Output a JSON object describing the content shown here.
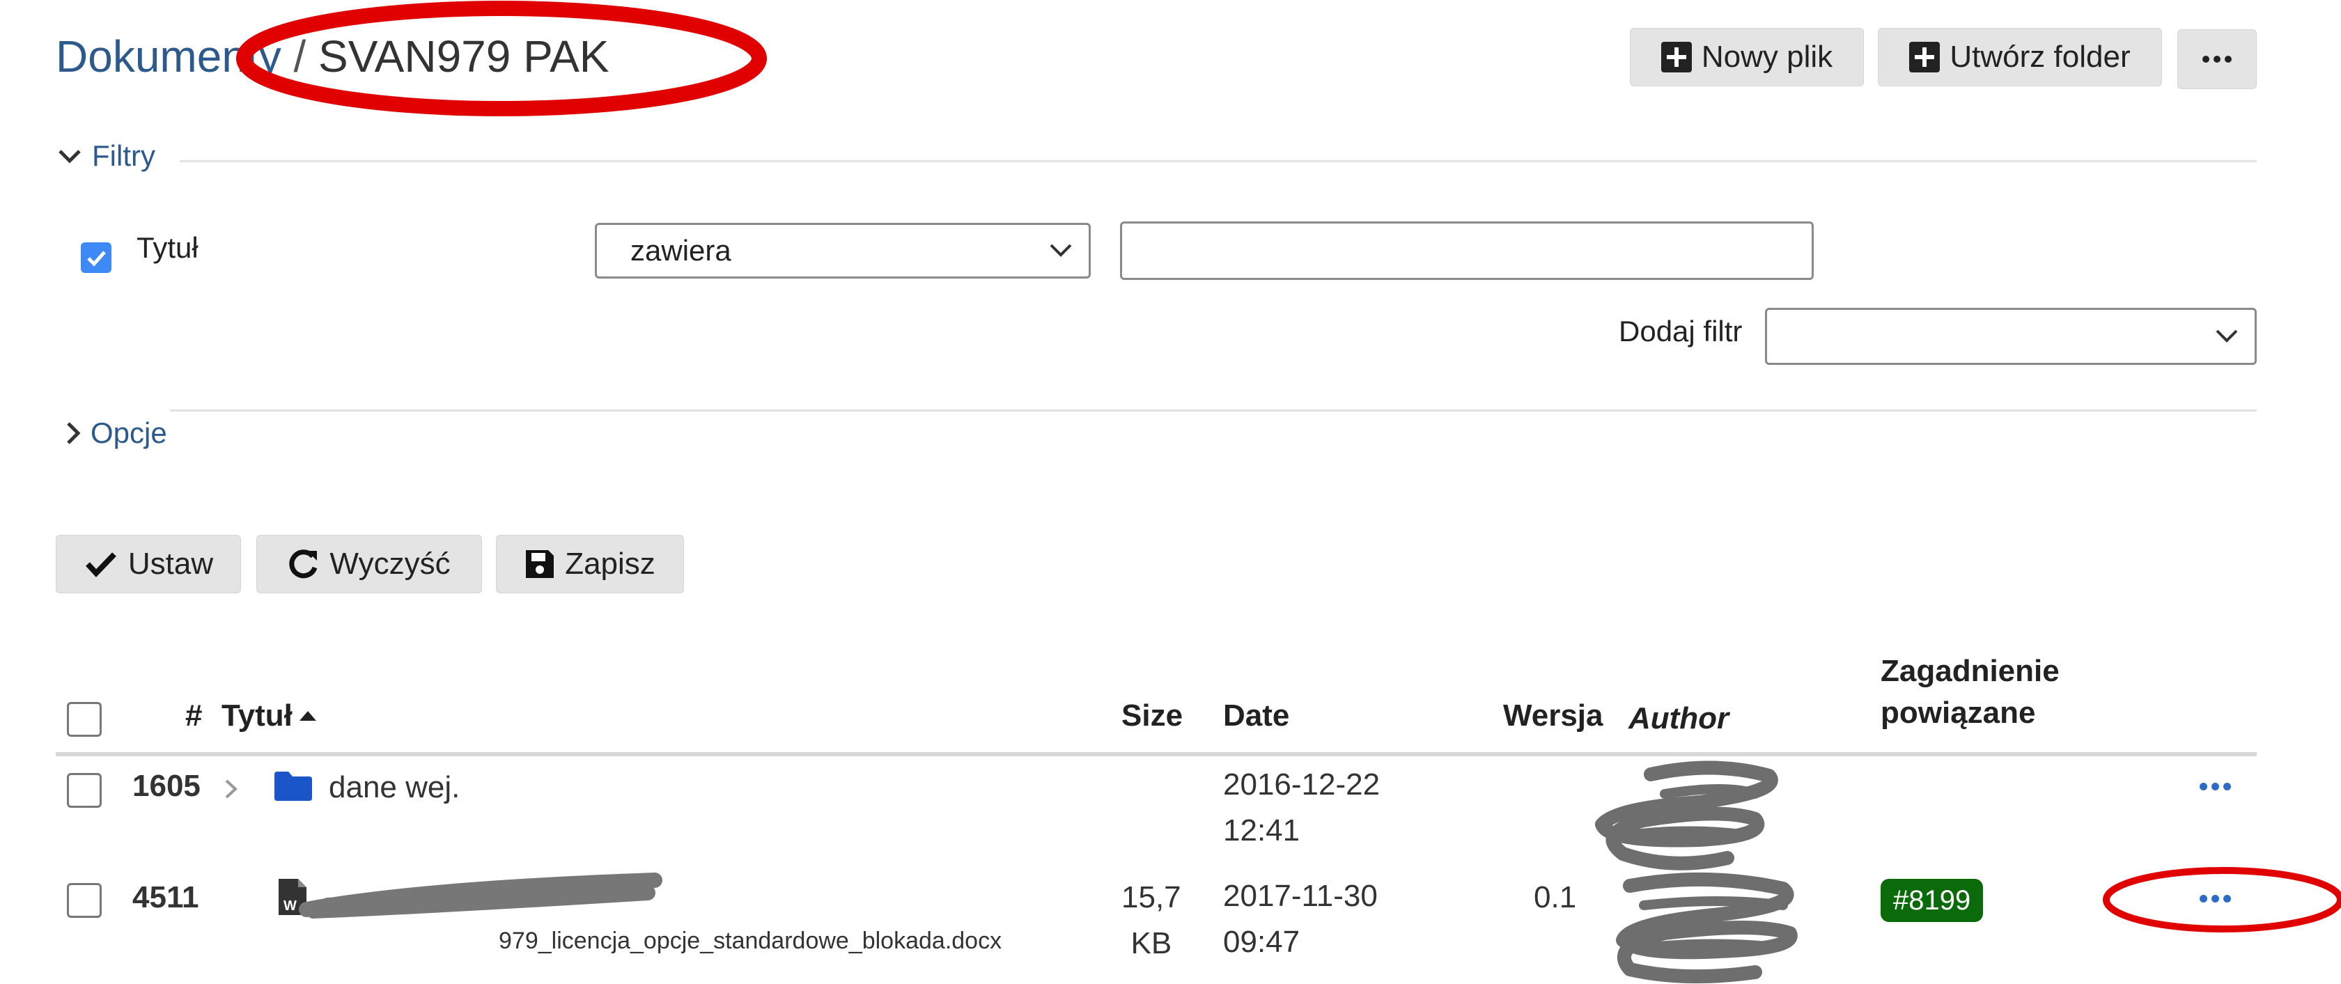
{
  "header": {
    "breadcrumb_root": "Dokumenty",
    "separator": " / ",
    "current_folder": "SVAN979 PAK"
  },
  "toolbar": {
    "new_file_label": "Nowy plik",
    "create_folder_label": "Utwórz folder"
  },
  "filters": {
    "legend": "Filtry",
    "title_filter": {
      "label": "Tytuł",
      "checked": true,
      "operator": "zawiera",
      "value": ""
    },
    "add_filter_label": "Dodaj filtr",
    "add_filter_value": ""
  },
  "options": {
    "legend": "Opcje"
  },
  "actions": {
    "apply_label": "Ustaw",
    "clear_label": "Wyczyść",
    "save_label": "Zapisz"
  },
  "table": {
    "headers": {
      "id": "#",
      "title": "Tytuł",
      "size": "Size",
      "date": "Date",
      "version": "Wersja",
      "author": "Author",
      "related_line1": "Zagadnienie",
      "related_line2": "powiązane"
    },
    "rows": [
      {
        "id": "1605",
        "type": "folder",
        "title": "dane wej.",
        "filename": "",
        "size_line1": "",
        "size_line2": "",
        "date_line1": "2016-12-22",
        "date_line2": "12:41",
        "version": "",
        "related": ""
      },
      {
        "id": "4511",
        "type": "word-file",
        "title": "",
        "filename": "979_licencja_opcje_standardowe_blokada.docx",
        "size_line1": "15,7",
        "size_line2": "KB",
        "date_line1": "2017-11-30",
        "date_line2": "09:47",
        "version": "0.1",
        "related": "#8199"
      }
    ]
  },
  "colors": {
    "link": "#2d6bc4",
    "badge": "#0b6b0b",
    "annotation_red": "#e00000",
    "checkbox_checked": "#3d8af7"
  }
}
